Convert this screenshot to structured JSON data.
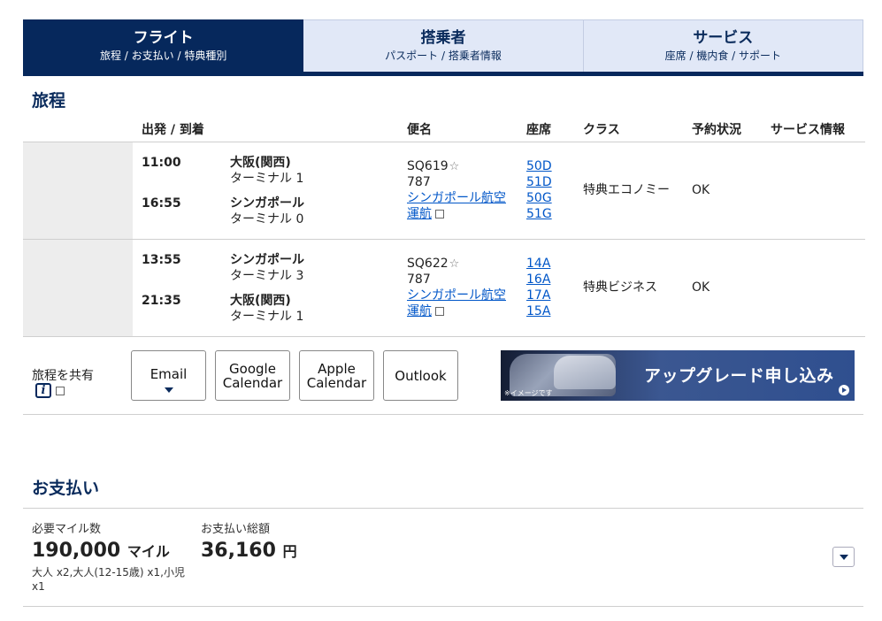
{
  "tabs": [
    {
      "title": "フライト",
      "subtitle": "旅程 / お支払い / 特典種別"
    },
    {
      "title": "搭乗者",
      "subtitle": "パスポート / 搭乗者情報"
    },
    {
      "title": "サービス",
      "subtitle": "座席 / 機内食 / サポート"
    }
  ],
  "itinerary": {
    "heading": "旅程",
    "columns": {
      "dep_arr": "出発 / 到着",
      "flight": "便名",
      "seat": "座席",
      "class": "クラス",
      "status": "予約状況",
      "service": "サービス情報"
    },
    "segments": [
      {
        "dep_time": "11:00",
        "dep_city": "大阪(関西)",
        "dep_terminal": "ターミナル 1",
        "arr_time": "16:55",
        "arr_city": "シンガポール",
        "arr_terminal": "ターミナル 0",
        "flight_no": "SQ619",
        "aircraft": "787",
        "operator_line1": "シンガポール航空",
        "operator_line2": "運航",
        "seats": [
          "50D",
          "51D",
          "50G",
          "51G"
        ],
        "cabin": "特典エコノミー",
        "status": "OK"
      },
      {
        "dep_time": "13:55",
        "dep_city": "シンガポール",
        "dep_terminal": "ターミナル 3",
        "arr_time": "21:35",
        "arr_city": "大阪(関西)",
        "arr_terminal": "ターミナル 1",
        "flight_no": "SQ622",
        "aircraft": "787",
        "operator_line1": "シンガポール航空",
        "operator_line2": "運航",
        "seats": [
          "14A",
          "16A",
          "17A",
          "15A"
        ],
        "cabin": "特典ビジネス",
        "status": "OK"
      }
    ]
  },
  "share": {
    "label": "旅程を共有",
    "info_glyph": "i",
    "buttons": {
      "email": "Email",
      "google_1": "Google",
      "google_2": "Calendar",
      "apple_1": "Apple",
      "apple_2": "Calendar",
      "outlook": "Outlook"
    },
    "banner_text": "アップグレード申し込み",
    "banner_note": "※イメージです"
  },
  "payment": {
    "heading": "お支払い",
    "miles_label": "必要マイル数",
    "miles_value": "190,000",
    "miles_unit": "マイル",
    "passengers": "大人 x2,大人(12-15歳) x1,小児 x1",
    "total_label": "お支払い総額",
    "total_value": "36,160",
    "total_unit": "円"
  },
  "icons": {
    "star": "star-outline-icon",
    "external": "external-link-icon",
    "info": "info-icon",
    "caret": "chevron-down-icon"
  }
}
